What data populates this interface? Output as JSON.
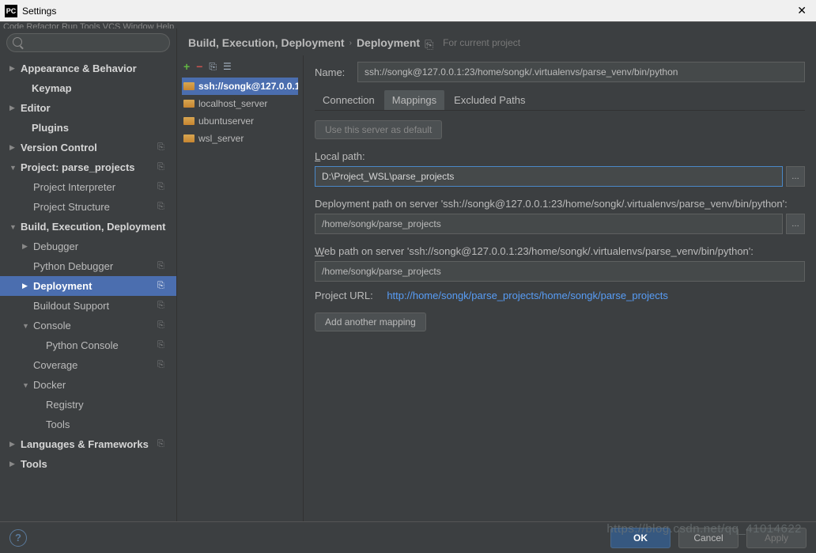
{
  "window": {
    "title": "Settings"
  },
  "menubar": "  Code  Refactor  Run  Tools  VCS  Window  Help",
  "search": {
    "placeholder": ""
  },
  "sidebar": [
    {
      "label": "Appearance & Behavior",
      "depth": 0,
      "arrow": "▶",
      "bold": true,
      "copy": false
    },
    {
      "label": "Keymap",
      "depth": 0,
      "arrow": "",
      "bold": true,
      "copy": false,
      "noindent": true
    },
    {
      "label": "Editor",
      "depth": 0,
      "arrow": "▶",
      "bold": true,
      "copy": false
    },
    {
      "label": "Plugins",
      "depth": 0,
      "arrow": "",
      "bold": true,
      "copy": false,
      "noindent": true
    },
    {
      "label": "Version Control",
      "depth": 0,
      "arrow": "▶",
      "bold": true,
      "copy": true
    },
    {
      "label": "Project: parse_projects",
      "depth": 0,
      "arrow": "▼",
      "bold": true,
      "copy": true
    },
    {
      "label": "Project Interpreter",
      "depth": 1,
      "arrow": "",
      "bold": false,
      "copy": true
    },
    {
      "label": "Project Structure",
      "depth": 1,
      "arrow": "",
      "bold": false,
      "copy": true
    },
    {
      "label": "Build, Execution, Deployment",
      "depth": 0,
      "arrow": "▼",
      "bold": true,
      "copy": false
    },
    {
      "label": "Debugger",
      "depth": 1,
      "arrow": "▶",
      "bold": false,
      "copy": false
    },
    {
      "label": "Python Debugger",
      "depth": 1,
      "arrow": "",
      "bold": false,
      "copy": true
    },
    {
      "label": "Deployment",
      "depth": 1,
      "arrow": "▶",
      "bold": true,
      "copy": true,
      "selected": true
    },
    {
      "label": "Buildout Support",
      "depth": 1,
      "arrow": "",
      "bold": false,
      "copy": true
    },
    {
      "label": "Console",
      "depth": 1,
      "arrow": "▼",
      "bold": false,
      "copy": true
    },
    {
      "label": "Python Console",
      "depth": 2,
      "arrow": "",
      "bold": false,
      "copy": true
    },
    {
      "label": "Coverage",
      "depth": 1,
      "arrow": "",
      "bold": false,
      "copy": true
    },
    {
      "label": "Docker",
      "depth": 1,
      "arrow": "▼",
      "bold": false,
      "copy": false
    },
    {
      "label": "Registry",
      "depth": 2,
      "arrow": "",
      "bold": false,
      "copy": false
    },
    {
      "label": "Tools",
      "depth": 2,
      "arrow": "",
      "bold": false,
      "copy": false
    },
    {
      "label": "Languages & Frameworks",
      "depth": 0,
      "arrow": "▶",
      "bold": true,
      "copy": true
    },
    {
      "label": "Tools",
      "depth": 0,
      "arrow": "▶",
      "bold": true,
      "copy": false
    }
  ],
  "breadcrumb": {
    "a": "Build, Execution, Deployment",
    "b": "Deployment",
    "hint": "For current project"
  },
  "servers": [
    {
      "name": "ssh://songk@127.0.0.1:",
      "selected": true
    },
    {
      "name": "localhost_server",
      "selected": false
    },
    {
      "name": "ubuntuserver",
      "selected": false
    },
    {
      "name": "wsl_server",
      "selected": false
    }
  ],
  "form": {
    "name_label": "Name:",
    "name_value": "ssh://songk@127.0.0.1:23/home/songk/.virtualenvs/parse_venv/bin/python",
    "tabs": {
      "connection": "Connection",
      "mappings": "Mappings",
      "excluded": "Excluded Paths"
    },
    "default_btn": "Use this server as default",
    "local_label": "Local path:",
    "local_value": "D:\\Project_WSL\\parse_projects",
    "deploy_label": "Deployment path on server 'ssh://songk@127.0.0.1:23/home/songk/.virtualenvs/parse_venv/bin/python':",
    "deploy_value": "/home/songk/parse_projects",
    "web_label": "Web path on server 'ssh://songk@127.0.0.1:23/home/songk/.virtualenvs/parse_venv/bin/python':",
    "web_value": "/home/songk/parse_projects",
    "url_label": "Project URL:",
    "url_value": "http://home/songk/parse_projects/home/songk/parse_projects",
    "add_mapping": "Add another mapping"
  },
  "footer": {
    "ok": "OK",
    "cancel": "Cancel",
    "apply": "Apply"
  },
  "watermark": "https://blog.csdn.net/qq_41014622"
}
